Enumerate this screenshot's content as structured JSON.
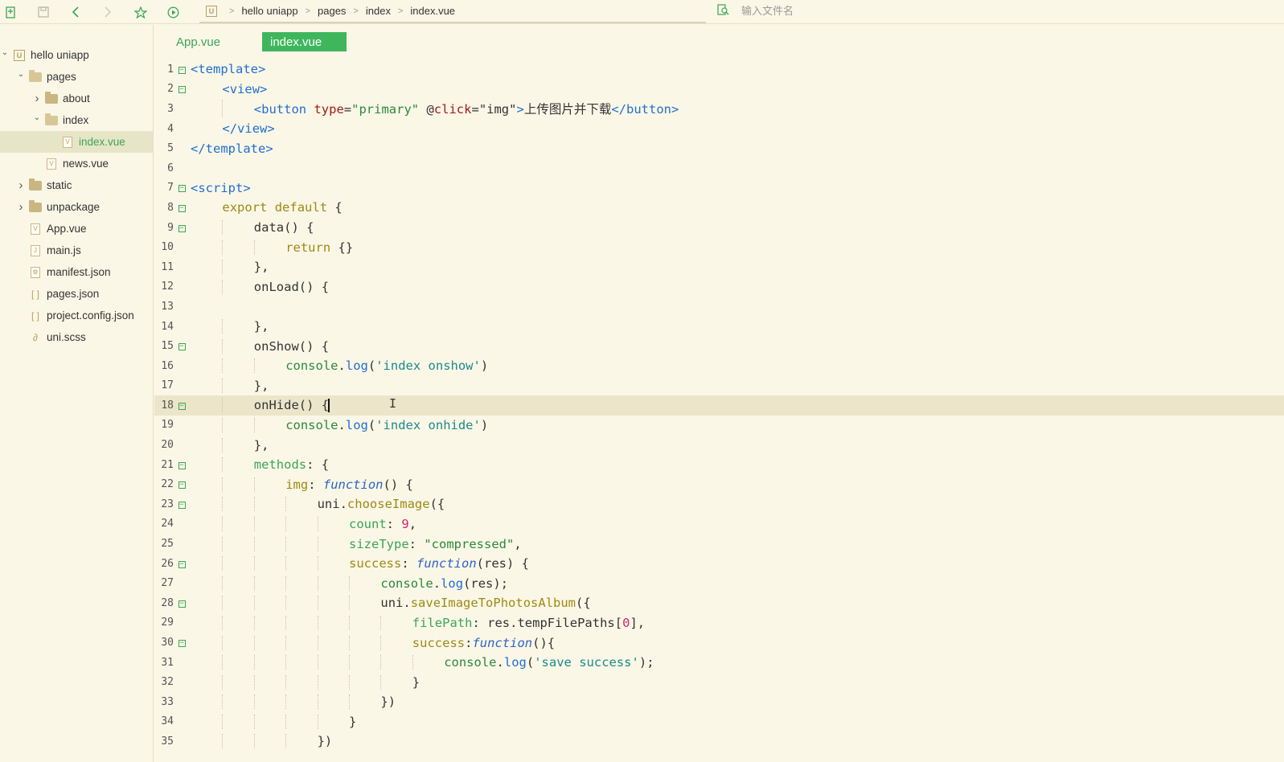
{
  "toolbar": {
    "icons": [
      "new-file-icon",
      "save-icon",
      "back-icon",
      "forward-icon",
      "star-icon",
      "run-icon"
    ],
    "breadcrumb": [
      "hello uniapp",
      "pages",
      "index",
      "index.vue"
    ],
    "search_placeholder": "输入文件名"
  },
  "sidebar": {
    "tree": [
      {
        "label": "hello uniapp",
        "type": "project",
        "level": 0,
        "expanded": true
      },
      {
        "label": "pages",
        "type": "folder",
        "level": 1,
        "expanded": true
      },
      {
        "label": "about",
        "type": "folder",
        "level": 2,
        "expanded": false
      },
      {
        "label": "index",
        "type": "folder",
        "level": 2,
        "expanded": true
      },
      {
        "label": "index.vue",
        "type": "vue",
        "level": 3,
        "selected": true
      },
      {
        "label": "news.vue",
        "type": "vue",
        "level": 2
      },
      {
        "label": "static",
        "type": "folder",
        "level": 1,
        "expanded": false
      },
      {
        "label": "unpackage",
        "type": "folder",
        "level": 1,
        "expanded": false
      },
      {
        "label": "App.vue",
        "type": "vue",
        "level": 1
      },
      {
        "label": "main.js",
        "type": "js",
        "level": 1
      },
      {
        "label": "manifest.json",
        "type": "manifest",
        "level": 1
      },
      {
        "label": "pages.json",
        "type": "json",
        "level": 1
      },
      {
        "label": "project.config.json",
        "type": "json",
        "level": 1
      },
      {
        "label": "uni.scss",
        "type": "scss",
        "level": 1
      }
    ]
  },
  "tabs": [
    {
      "label": "App.vue",
      "active": false
    },
    {
      "label": "index.vue",
      "active": true
    }
  ],
  "editor": {
    "current_line": 18,
    "lines": [
      {
        "n": "1",
        "fold": true,
        "indent": 0,
        "tokens": [
          [
            "tag",
            "<template>"
          ]
        ]
      },
      {
        "n": "2",
        "fold": true,
        "indent": 1,
        "tokens": [
          [
            "tag",
            "<view>"
          ]
        ]
      },
      {
        "n": "3",
        "fold": false,
        "indent": 2,
        "tokens": [
          [
            "tag",
            "<button "
          ],
          [
            "attr",
            "type"
          ],
          [
            "plain",
            "="
          ],
          [
            "str",
            "\"primary\""
          ],
          [
            "plain",
            " @"
          ],
          [
            "attr",
            "click"
          ],
          [
            "plain",
            "="
          ],
          [
            "plain",
            "\"img\""
          ],
          [
            "tag",
            ">"
          ],
          [
            "cn",
            "上传图片并下载"
          ],
          [
            "tag",
            "</button>"
          ]
        ]
      },
      {
        "n": "4",
        "fold": false,
        "indent": 1,
        "tokens": [
          [
            "tag",
            "</view>"
          ]
        ]
      },
      {
        "n": "5",
        "fold": false,
        "indent": 0,
        "tokens": [
          [
            "tag",
            "</template>"
          ]
        ]
      },
      {
        "n": "6",
        "fold": false,
        "indent": 0,
        "tokens": []
      },
      {
        "n": "7",
        "fold": true,
        "indent": 0,
        "tokens": [
          [
            "tag",
            "<script>"
          ]
        ]
      },
      {
        "n": "8",
        "fold": true,
        "indent": 1,
        "tokens": [
          [
            "kw",
            "export default"
          ],
          [
            "plain",
            " {"
          ]
        ]
      },
      {
        "n": "9",
        "fold": true,
        "indent": 2,
        "tokens": [
          [
            "plain",
            "data() {"
          ]
        ]
      },
      {
        "n": "10",
        "fold": false,
        "indent": 3,
        "tokens": [
          [
            "kw",
            "return"
          ],
          [
            "plain",
            " {}"
          ]
        ]
      },
      {
        "n": "11",
        "fold": false,
        "indent": 2,
        "tokens": [
          [
            "plain",
            "},"
          ]
        ]
      },
      {
        "n": "12",
        "fold": false,
        "indent": 2,
        "tokens": [
          [
            "plain",
            "onLoad() {"
          ]
        ]
      },
      {
        "n": "13",
        "fold": false,
        "indent": 2,
        "tokens": []
      },
      {
        "n": "14",
        "fold": false,
        "indent": 2,
        "tokens": [
          [
            "plain",
            "},"
          ]
        ]
      },
      {
        "n": "15",
        "fold": true,
        "indent": 2,
        "tokens": [
          [
            "plain",
            "onShow() {"
          ]
        ]
      },
      {
        "n": "16",
        "fold": false,
        "indent": 3,
        "tokens": [
          [
            "obj",
            "console"
          ],
          [
            "plain",
            "."
          ],
          [
            "log",
            "log"
          ],
          [
            "plain",
            "("
          ],
          [
            "sq",
            "'index onshow'"
          ],
          [
            "plain",
            ")"
          ]
        ]
      },
      {
        "n": "17",
        "fold": false,
        "indent": 2,
        "tokens": [
          [
            "plain",
            "},"
          ]
        ]
      },
      {
        "n": "18",
        "fold": true,
        "indent": 2,
        "tokens": [
          [
            "plain",
            "onHide() "
          ],
          [
            "plain",
            "{"
          ]
        ]
      },
      {
        "n": "19",
        "fold": false,
        "indent": 3,
        "tokens": [
          [
            "obj",
            "console"
          ],
          [
            "plain",
            "."
          ],
          [
            "log",
            "log"
          ],
          [
            "plain",
            "("
          ],
          [
            "sq",
            "'index onhide'"
          ],
          [
            "plain",
            ")"
          ]
        ]
      },
      {
        "n": "20",
        "fold": false,
        "indent": 2,
        "tokens": [
          [
            "plain",
            "},"
          ]
        ]
      },
      {
        "n": "21",
        "fold": true,
        "indent": 2,
        "tokens": [
          [
            "prop",
            "methods"
          ],
          [
            "plain",
            ": {"
          ]
        ]
      },
      {
        "n": "22",
        "fold": true,
        "indent": 3,
        "tokens": [
          [
            "meth",
            "img"
          ],
          [
            "plain",
            ": "
          ],
          [
            "func",
            "function"
          ],
          [
            "plain",
            "() {"
          ]
        ]
      },
      {
        "n": "23",
        "fold": true,
        "indent": 4,
        "tokens": [
          [
            "plain",
            "uni."
          ],
          [
            "meth",
            "chooseImage"
          ],
          [
            "plain",
            "({"
          ]
        ]
      },
      {
        "n": "24",
        "fold": false,
        "indent": 5,
        "tokens": [
          [
            "prop",
            "count"
          ],
          [
            "plain",
            ": "
          ],
          [
            "num",
            "9"
          ],
          [
            "plain",
            ","
          ]
        ]
      },
      {
        "n": "25",
        "fold": false,
        "indent": 5,
        "tokens": [
          [
            "prop",
            "sizeType"
          ],
          [
            "plain",
            ": "
          ],
          [
            "str",
            "\"compressed\""
          ],
          [
            "plain",
            ","
          ]
        ]
      },
      {
        "n": "26",
        "fold": true,
        "indent": 5,
        "tokens": [
          [
            "meth",
            "success"
          ],
          [
            "plain",
            ": "
          ],
          [
            "func",
            "function"
          ],
          [
            "plain",
            "(res) {"
          ]
        ]
      },
      {
        "n": "27",
        "fold": false,
        "indent": 6,
        "tokens": [
          [
            "obj",
            "console"
          ],
          [
            "plain",
            "."
          ],
          [
            "log",
            "log"
          ],
          [
            "plain",
            "(res);"
          ]
        ]
      },
      {
        "n": "28",
        "fold": true,
        "indent": 6,
        "tokens": [
          [
            "plain",
            "uni."
          ],
          [
            "meth",
            "saveImageToPhotosAlbum"
          ],
          [
            "plain",
            "({"
          ]
        ]
      },
      {
        "n": "29",
        "fold": false,
        "indent": 7,
        "tokens": [
          [
            "prop",
            "filePath"
          ],
          [
            "plain",
            ": res.tempFilePaths["
          ],
          [
            "num",
            "0"
          ],
          [
            "plain",
            "],"
          ]
        ]
      },
      {
        "n": "30",
        "fold": true,
        "indent": 7,
        "tokens": [
          [
            "meth",
            "success"
          ],
          [
            "plain",
            ":"
          ],
          [
            "func",
            "function"
          ],
          [
            "plain",
            "(){"
          ]
        ]
      },
      {
        "n": "31",
        "fold": false,
        "indent": 8,
        "tokens": [
          [
            "obj",
            "console"
          ],
          [
            "plain",
            "."
          ],
          [
            "log",
            "log"
          ],
          [
            "plain",
            "("
          ],
          [
            "sq",
            "'save success'"
          ],
          [
            "plain",
            ");"
          ]
        ]
      },
      {
        "n": "32",
        "fold": false,
        "indent": 7,
        "tokens": [
          [
            "plain",
            "}"
          ]
        ]
      },
      {
        "n": "33",
        "fold": false,
        "indent": 6,
        "tokens": [
          [
            "plain",
            "})"
          ]
        ]
      },
      {
        "n": "34",
        "fold": false,
        "indent": 5,
        "tokens": [
          [
            "plain",
            "}"
          ]
        ]
      },
      {
        "n": "35",
        "fold": false,
        "indent": 4,
        "tokens": [
          [
            "plain",
            "})"
          ]
        ]
      }
    ]
  },
  "colors": {
    "background": "#fbf7e7",
    "accent": "#3fb65c",
    "tag": "#1f6fd1",
    "current_line": "#ece5ca"
  }
}
